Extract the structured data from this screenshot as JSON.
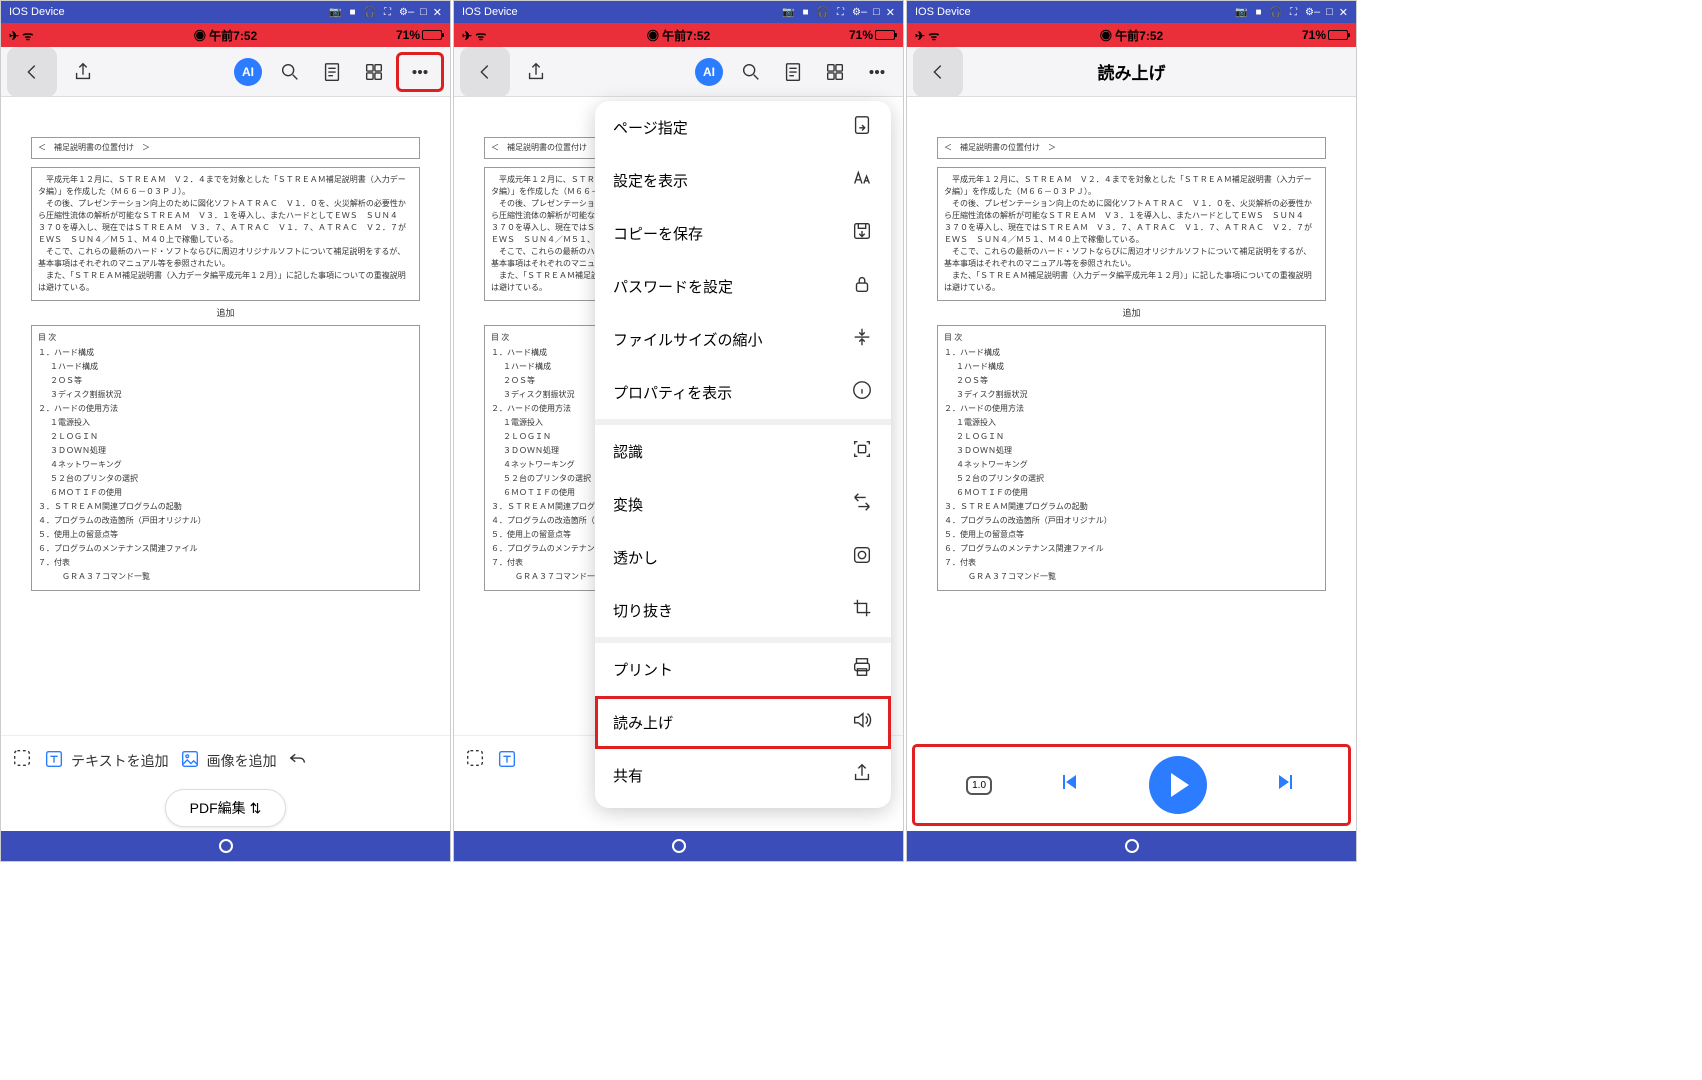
{
  "window": {
    "title": "IOS Device",
    "min": "–",
    "max": "□",
    "close": "✕"
  },
  "status": {
    "time": "午前7:52",
    "battery": "71%"
  },
  "toolbar": {
    "ai_label": "AI"
  },
  "doc": {
    "header": "＜　補足説明書の位置付け　＞",
    "body": "　平成元年１２月に、ＳＴＲＥＡＭ　Ｖ２．４までを対象とした「ＳＴＲＥＡＭ補足説明書（入力データ編）」を作成した（Ｍ６６－０３ＰＪ）。\n　その後、プレゼンテーション向上のために図化ソフトＡＴＲＡＣ　Ｖ１．０を、火災解析の必要性から圧縮性流体の解析が可能なＳＴＲＥＡＭ　Ｖ３．１を導入し、またハードとしてＥＷＳ　ＳＵＮ４　３７０を導入し、現在ではＳＴＲＥＡＭ　Ｖ３．７、ＡＴＲＡＣ　Ｖ１．７、ＡＴＲＡＣ　Ｖ２．７が　ＥＷＳ　ＳＵＮ４／Ｍ５１、Ｍ４０上で稼働している。\n　そこで、これらの最新のハード・ソフトならびに周辺オリジナルソフトについて補足説明をするが、基本事項はそれぞれのマニュアル等を参照されたい。\n　また、「ＳＴＲＥＡＭ補足説明書（入力データ編平成元年１２月）」に記した事項についての重複説明は避けている。",
    "add": "追加",
    "contents_label": "目 次",
    "toc": [
      {
        "t": "１．ハード構成",
        "l": 0
      },
      {
        "t": "１ハード構成",
        "l": 1
      },
      {
        "t": "２ＯＳ等",
        "l": 1
      },
      {
        "t": "３ディスク割振状況",
        "l": 1
      },
      {
        "t": "２．ハードの使用方法",
        "l": 0
      },
      {
        "t": "１電源投入",
        "l": 1
      },
      {
        "t": "２ＬＯＧＩＮ",
        "l": 1
      },
      {
        "t": "３ＤＯＷＮ処理",
        "l": 1
      },
      {
        "t": "４ネットワーキング",
        "l": 1
      },
      {
        "t": "５２台のプリンタの選択",
        "l": 1
      },
      {
        "t": "６ＭＯＴＩＦの使用",
        "l": 1
      },
      {
        "t": "３．ＳＴＲＥＡＭ関連プログラムの起動",
        "l": 0
      },
      {
        "t": "４．プログラムの改造箇所（戸田オリジナル）",
        "l": 0
      },
      {
        "t": "５．使用上の留意点等",
        "l": 0
      },
      {
        "t": "６．プログラムのメンテナンス関連ファイル",
        "l": 0
      },
      {
        "t": "７．付表",
        "l": 0
      },
      {
        "t": "ＧＲＡ３７コマンド一覧",
        "l": 2
      }
    ]
  },
  "bottom": {
    "add_text": "テキストを追加",
    "add_image": "画像を追加",
    "pdf_edit": "PDF編集"
  },
  "menu": {
    "items": [
      {
        "label": "ページ指定",
        "icon": "goto-icon"
      },
      {
        "label": "設定を表示",
        "icon": "textsize-icon"
      },
      {
        "label": "コピーを保存",
        "icon": "save-icon"
      },
      {
        "label": "パスワードを設定",
        "icon": "lock-icon"
      },
      {
        "label": "ファイルサイズの縮小",
        "icon": "compress-icon"
      },
      {
        "label": "プロパティを表示",
        "icon": "info-icon"
      }
    ],
    "items2": [
      {
        "label": "認識",
        "icon": "ocr-icon"
      },
      {
        "label": "変換",
        "icon": "convert-icon"
      },
      {
        "label": "透かし",
        "icon": "watermark-icon"
      },
      {
        "label": "切り抜き",
        "icon": "crop-icon"
      }
    ],
    "items3": [
      {
        "label": "プリント",
        "icon": "print-icon"
      },
      {
        "label": "読み上げ",
        "icon": "speaker-icon",
        "hl": true
      },
      {
        "label": "共有",
        "icon": "share-icon"
      }
    ]
  },
  "reader": {
    "title": "読み上げ",
    "speed": "1.0"
  }
}
